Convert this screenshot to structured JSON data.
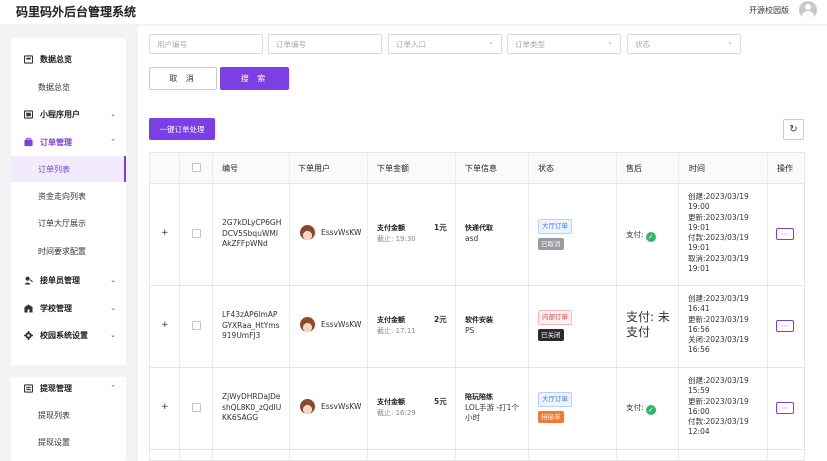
{
  "header": {
    "title": "码里码外后台管理系统",
    "campus_link": "开源校园版"
  },
  "sidebar": {
    "groups": [
      {
        "label": "数据总览",
        "icon": "dashboard-icon",
        "items": [
          "数据总览"
        ]
      },
      {
        "label": "小程序用户",
        "icon": "user-icon"
      },
      {
        "label": "订单管理",
        "icon": "order-icon",
        "items": [
          "订单列表",
          "资金走向列表",
          "订单大厅展示",
          "时间要求配置"
        ]
      },
      {
        "label": "接单员管理",
        "icon": "staff-icon"
      },
      {
        "label": "学校管理",
        "icon": "school-icon"
      },
      {
        "label": "校园系统设置",
        "icon": "settings-icon"
      },
      {
        "label": "提现管理",
        "icon": "withdraw-icon",
        "items": [
          "提现列表",
          "提现设置"
        ]
      }
    ]
  },
  "filters": {
    "user_id_placeholder": "用户编号",
    "order_id_placeholder": "订单编号",
    "order_entry_placeholder": "订单入口",
    "order_type_placeholder": "订单类型",
    "status_placeholder": "状态"
  },
  "buttons": {
    "cancel": "取 消",
    "search": "搜 索",
    "batch": "一键订单处理"
  },
  "table": {
    "headers": [
      "编号",
      "下单用户",
      "下单金额",
      "下单信息",
      "状态",
      "售后",
      "时间",
      "操作"
    ],
    "rows": [
      {
        "id": "2G7kDLyCP6GHDCV5SbquWMIAkZFFpWNd",
        "user": "EssvWsKW",
        "amount_label": "支付金额",
        "deadline": "截止: 19:30",
        "amount": "1元",
        "info_title": "快递代取",
        "info_sub": "asd",
        "tags": [
          "大厅订单",
          "已取消"
        ],
        "aftersale": "支付: ",
        "times": [
          "创建:2023/03/19",
          "19:00",
          "更新:2023/03/19",
          "19:01",
          "付款:2023/03/19",
          "19:01",
          "取消:2023/03/19",
          "19:01"
        ]
      },
      {
        "id": "LF43zAP6lmAPGYXRaa_HtYms919UmFJ3",
        "user": "EssvWsKW",
        "amount_label": "支付金额",
        "deadline": "截止: 17:11",
        "amount": "2元",
        "info_title": "软件安装",
        "info_sub": "PS",
        "tags": [
          "内部订单",
          "已关闭"
        ],
        "aftersale": "支付: 未支付",
        "times": [
          "创建:2023/03/19",
          "16:41",
          "更新:2023/03/19",
          "16:56",
          "关闭:2023/03/19",
          "16:56"
        ]
      },
      {
        "id": "ZjWyDHRDaJDeshQL8K0_zQdIUKK6SAGG",
        "user": "EssvWsKW",
        "amount_label": "支付金额",
        "deadline": "截止: 16:29",
        "amount": "5元",
        "info_title": "陪玩陪练",
        "info_sub": "LOL手游 -打1个小时",
        "tags": [
          "大厅订单",
          "待接单"
        ],
        "aftersale": "支付: ",
        "times": [
          "创建:2023/03/19",
          "15:59",
          "更新:2023/03/19",
          "16:00",
          "付款:2023/03/19",
          "12:04"
        ]
      }
    ]
  },
  "colors": {
    "accent": "#7b3fe4",
    "paid": "#2fb56a"
  }
}
